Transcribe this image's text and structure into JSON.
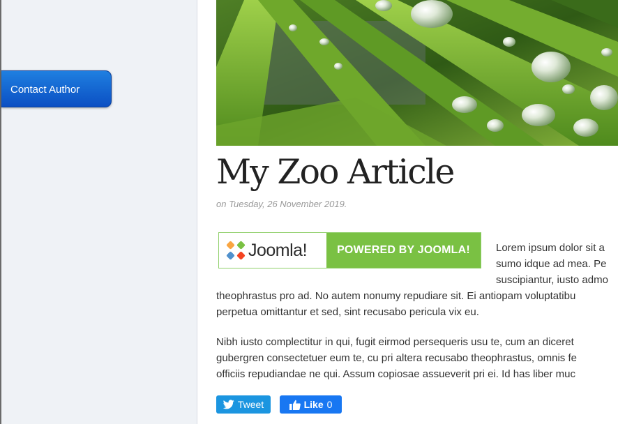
{
  "sidebar": {
    "contact_label": "Contact Author"
  },
  "article": {
    "hero_image": "grass-water-droplets-photo",
    "title": "My Zoo Article",
    "date": "on Tuesday, 26 November 2019.",
    "banner": {
      "logo_icon": "joomla-logo-icon",
      "logo_text": "Joomla!",
      "powered_text": "POWERED BY JOOMLA!"
    },
    "float_lines": [
      "Lorem ipsum dolor sit a",
      "sumo idque ad mea. Pe",
      "suscipiantur, iusto admo"
    ],
    "para1_lines": [
      "theophrastus pro ad. No autem nonumy repudiare sit. Ei antiopam voluptatibu",
      "perpetua omittantur et sed, sint recusabo pericula vix eu."
    ],
    "para2_lines": [
      "Nibh iusto complectitur in qui, fugit eirmod persequeris usu te, cum an diceret",
      "gubergren consectetuer eum te, cu pri altera recusabo theophrastus, omnis fe",
      "officiis repudiandae ne qui. Assum copiosae assueverit pri ei. Id has liber muc"
    ]
  },
  "social": {
    "tweet_label": "Tweet",
    "tweet_icon": "twitter-bird-icon",
    "like_label": "Like",
    "like_count": "0",
    "like_icon": "thumbs-up-icon"
  },
  "colors": {
    "sidebar_bg": "#eff2f6",
    "button_blue": "#0b4fc3",
    "joomla_green": "#7ac143",
    "twitter_blue": "#1b95e0",
    "facebook_blue": "#1877f2"
  }
}
